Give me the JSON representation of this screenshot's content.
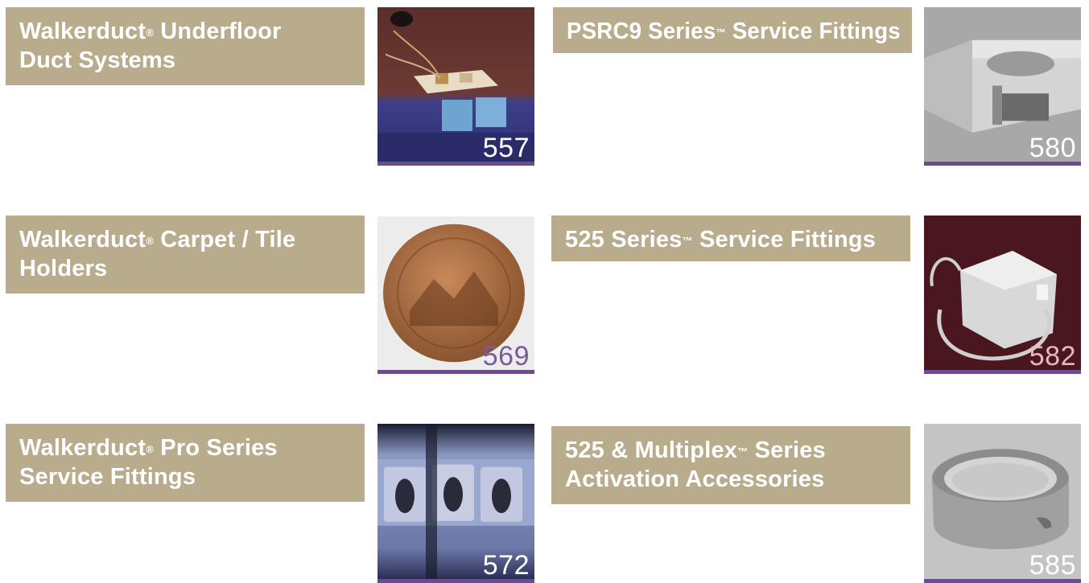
{
  "items": [
    {
      "title_line1": "Walkerduct",
      "mark1": "®",
      "title_line1b": " Underfloor",
      "title_line2": "Duct Systems",
      "page": "557"
    },
    {
      "title_line1": "PSRC9 Series",
      "mark1": "™",
      "title_line1b": " Service Fittings",
      "title_line2": "",
      "page": "580"
    },
    {
      "title_line1": "Walkerduct",
      "mark1": "®",
      "title_line1b": " Carpet / Tile",
      "title_line2": "Holders",
      "page": "569"
    },
    {
      "title_line1": "525 Series",
      "mark1": "™",
      "title_line1b": " Service Fittings",
      "title_line2": "",
      "page": "582"
    },
    {
      "title_line1": "Walkerduct",
      "mark1": "®",
      "title_line1b": " Pro Series",
      "title_line2": "Service Fittings",
      "page": "572"
    },
    {
      "title_line1": "525 & Multiplex",
      "mark1": "™",
      "title_line1b": " Series",
      "title_line2": "Activation Accessories",
      "page": "585"
    }
  ],
  "colors": {
    "banner": "#b8ac8c",
    "accent_bar": "#6b4c8c",
    "page_number_purple": "#7a5a9e"
  }
}
